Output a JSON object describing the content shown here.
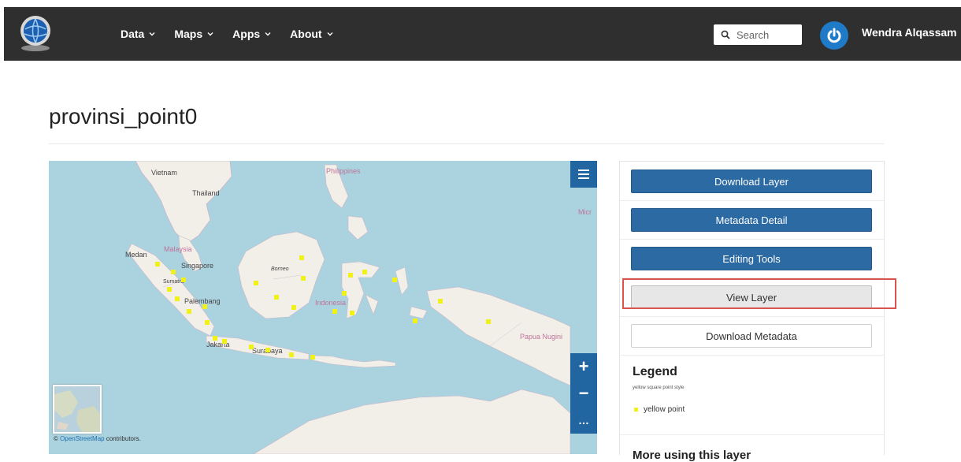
{
  "header": {
    "nav": [
      {
        "label": "Data"
      },
      {
        "label": "Maps"
      },
      {
        "label": "Apps"
      },
      {
        "label": "About"
      }
    ],
    "search_placeholder": "Search",
    "user_name": "Wendra Alqassam"
  },
  "page": {
    "title": "provinsi_point0"
  },
  "map": {
    "labels": {
      "vietnam": "Vietnam",
      "thailand": "Thailand",
      "philippines": "Philippines",
      "micronesia": "Micr",
      "medan": "Medan",
      "malaysia": "Malaysia",
      "singapore": "Singapore",
      "sumatra": "Sumatra",
      "borneo": "Borneo",
      "palembang": "Palembang",
      "indonesia": "Indonesia",
      "jakarta": "Jakarta",
      "surabaya": "Surabaya",
      "papua": "Papua Nugini"
    },
    "zoom_in": "+",
    "zoom_out": "−",
    "more": "…",
    "attribution_prefix": "©",
    "attribution_link": "OpenStreetMap",
    "attribution_suffix": "contributors.",
    "point_color": "#f1f11a",
    "land_color": "#f2efe9",
    "water_color": "#aad3df"
  },
  "panel": {
    "download_layer": "Download Layer",
    "metadata_detail": "Metadata Detail",
    "editing_tools": "Editing Tools",
    "view_layer": "View Layer",
    "download_metadata": "Download Metadata",
    "legend": {
      "title": "Legend",
      "subtitle": "yellow square point style",
      "item": "yellow point"
    },
    "more_title": "More using this layer"
  },
  "colors": {
    "topbar": "#2f2f2f",
    "primary_button": "#2c6aa3",
    "highlight_border": "#d9534f",
    "avatar": "#1f7ac8"
  }
}
